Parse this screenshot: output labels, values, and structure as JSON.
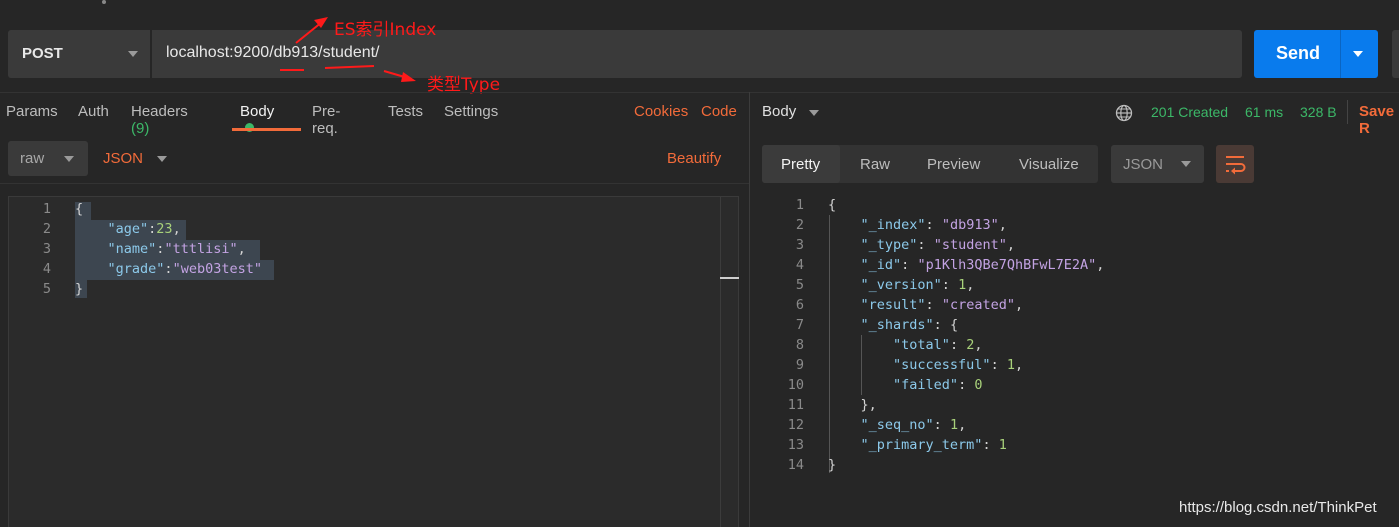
{
  "request": {
    "method": "POST",
    "url": "localhost:9200/db913/student/",
    "send_label": "Send"
  },
  "annotations": {
    "index_note": "ES索引Index",
    "type_note": "类型Type"
  },
  "request_tabs": {
    "params": "Params",
    "auth": "Auth",
    "headers": "Headers",
    "headers_count": "(9)",
    "body": "Body",
    "prereq": "Pre-req.",
    "tests": "Tests",
    "settings": "Settings",
    "cookies": "Cookies",
    "code": "Code"
  },
  "body_options": {
    "mode": "raw",
    "format": "JSON",
    "beautify": "Beautify"
  },
  "request_body_lines": [
    {
      "num": "1",
      "text": "{"
    },
    {
      "num": "2",
      "text": "    \"age\":23,"
    },
    {
      "num": "3",
      "text": "    \"name\":\"tttlisi\","
    },
    {
      "num": "4",
      "text": "    \"grade\":\"web03test\""
    },
    {
      "num": "5",
      "text": "}"
    }
  ],
  "response": {
    "title": "Body",
    "status": "201 Created",
    "time": "61 ms",
    "size": "328 B",
    "save_label": "Save R",
    "view_tabs": [
      "Pretty",
      "Raw",
      "Preview",
      "Visualize"
    ],
    "format": "JSON"
  },
  "response_lines": [
    {
      "num": "1",
      "text": "{"
    },
    {
      "num": "2",
      "text": "    \"_index\": \"db913\","
    },
    {
      "num": "3",
      "text": "    \"_type\": \"student\","
    },
    {
      "num": "4",
      "text": "    \"_id\": \"p1Klh3QBe7QhBFwL7E2A\","
    },
    {
      "num": "5",
      "text": "    \"_version\": 1,"
    },
    {
      "num": "6",
      "text": "    \"result\": \"created\","
    },
    {
      "num": "7",
      "text": "    \"_shards\": {"
    },
    {
      "num": "8",
      "text": "        \"total\": 2,"
    },
    {
      "num": "9",
      "text": "        \"successful\": 1,"
    },
    {
      "num": "10",
      "text": "        \"failed\": 0"
    },
    {
      "num": "11",
      "text": "    },"
    },
    {
      "num": "12",
      "text": "    \"_seq_no\": 1,"
    },
    {
      "num": "13",
      "text": "    \"_primary_term\": 1"
    },
    {
      "num": "14",
      "text": "}"
    }
  ],
  "watermark": "https://blog.csdn.net/ThinkPet",
  "colors": {
    "accent": "#f26b3a",
    "send": "#097bed",
    "success": "#3cb868",
    "annotation": "#ff1a1a"
  }
}
